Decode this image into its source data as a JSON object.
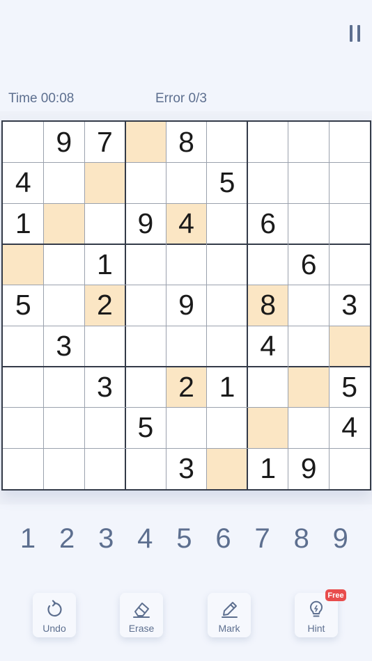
{
  "header": {
    "time_label": "Time 00:08",
    "error_label": "Error 0/3"
  },
  "board": {
    "cells": [
      [
        "",
        "9",
        "7",
        "",
        "8",
        "",
        "",
        "",
        ""
      ],
      [
        "4",
        "",
        "",
        "",
        "",
        "5",
        "",
        "",
        ""
      ],
      [
        "1",
        "",
        "",
        "9",
        "4",
        "",
        "6",
        "",
        ""
      ],
      [
        "",
        "",
        "1",
        "",
        "",
        "",
        "",
        "6",
        ""
      ],
      [
        "5",
        "",
        "2",
        "",
        "9",
        "",
        "8",
        "",
        "3"
      ],
      [
        "",
        "3",
        "",
        "",
        "",
        "",
        "4",
        "",
        ""
      ],
      [
        "",
        "",
        "3",
        "",
        "2",
        "1",
        "",
        "",
        "5"
      ],
      [
        "",
        "",
        "",
        "5",
        "",
        "",
        "",
        "",
        "4"
      ],
      [
        "",
        "",
        "",
        "",
        "3",
        "",
        "1",
        "9",
        ""
      ]
    ],
    "highlighted": [
      [
        0,
        3
      ],
      [
        1,
        2
      ],
      [
        2,
        1
      ],
      [
        2,
        4
      ],
      [
        3,
        0
      ],
      [
        4,
        2
      ],
      [
        4,
        6
      ],
      [
        5,
        8
      ],
      [
        6,
        4
      ],
      [
        6,
        7
      ],
      [
        7,
        6
      ],
      [
        8,
        5
      ]
    ],
    "highlight_color": "#fbe6c4"
  },
  "numpad": [
    "1",
    "2",
    "3",
    "4",
    "5",
    "6",
    "7",
    "8",
    "9"
  ],
  "tools": {
    "undo_label": "Undo",
    "erase_label": "Erase",
    "mark_label": "Mark",
    "hint_label": "Hint",
    "hint_badge": "Free"
  },
  "colors": {
    "background": "#f2f5fc",
    "accent": "#5d6f8f",
    "badge": "#e84c4c"
  }
}
